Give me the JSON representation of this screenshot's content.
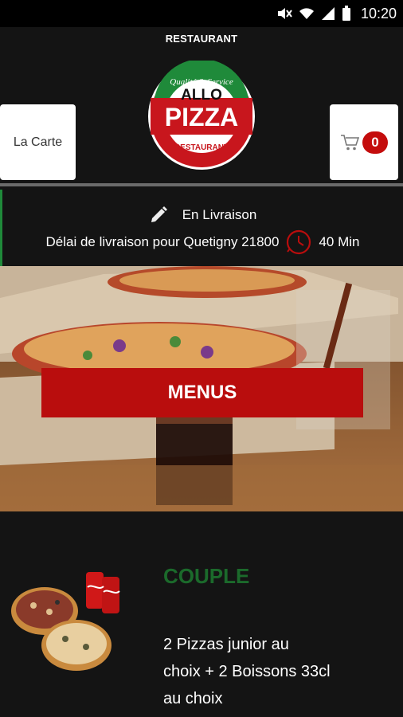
{
  "status_bar": {
    "time": "10:20",
    "icons": [
      "mute-icon",
      "wifi-icon",
      "signal-icon",
      "battery-icon"
    ]
  },
  "header": {
    "restaurant_label": "RESTAURANT",
    "logo": {
      "top": "Qualité & Service",
      "word1": "ALLO",
      "word2": "PIZZA",
      "bottom": "RESTAURANT"
    },
    "la_carte_label": "La Carte",
    "cart_count": "0"
  },
  "delivery": {
    "mode": "En Livraison",
    "info": "Délai de livraison pour Quetigny 21800",
    "time": "40 Min"
  },
  "hero": {
    "button_label": "MENUS"
  },
  "menu_item": {
    "title": "COUPLE",
    "description": "2 Pizzas junior au choix + 2 Boissons 33cl au choix"
  },
  "colors": {
    "accent_red": "#b90d0d",
    "brand_green": "#1b6a2b",
    "background": "#141414"
  }
}
